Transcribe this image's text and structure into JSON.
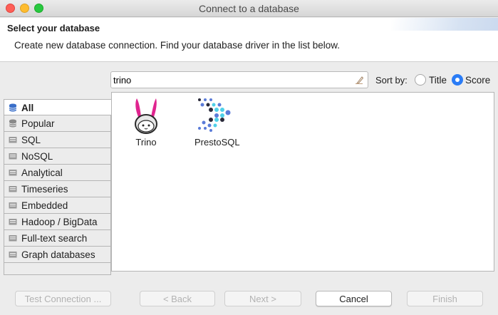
{
  "window": {
    "title": "Connect to a database"
  },
  "header": {
    "title": "Select your database",
    "description": "Create new database connection. Find your database driver in the list below."
  },
  "search": {
    "value": "trino"
  },
  "sort": {
    "label": "Sort by:",
    "options": [
      "Title",
      "Score"
    ],
    "selected": "Score"
  },
  "categories": [
    {
      "label": "All",
      "active": true
    },
    {
      "label": "Popular"
    },
    {
      "label": "SQL"
    },
    {
      "label": "NoSQL"
    },
    {
      "label": "Analytical"
    },
    {
      "label": "Timeseries"
    },
    {
      "label": "Embedded"
    },
    {
      "label": "Hadoop / BigData"
    },
    {
      "label": "Full-text search"
    },
    {
      "label": "Graph databases"
    }
  ],
  "drivers": [
    {
      "label": "Trino",
      "icon": "trino-bunny-icon"
    },
    {
      "label": "PrestoSQL",
      "icon": "prestosql-dots-icon"
    }
  ],
  "buttons": {
    "test": "Test Connection ...",
    "back": "< Back",
    "next": "Next >",
    "cancel": "Cancel",
    "finish": "Finish"
  },
  "colors": {
    "accent": "#2a7cf6",
    "trino_pink": "#e0248f",
    "presto_cyan": "#4fd0e8",
    "presto_blue": "#5a7bd8"
  }
}
